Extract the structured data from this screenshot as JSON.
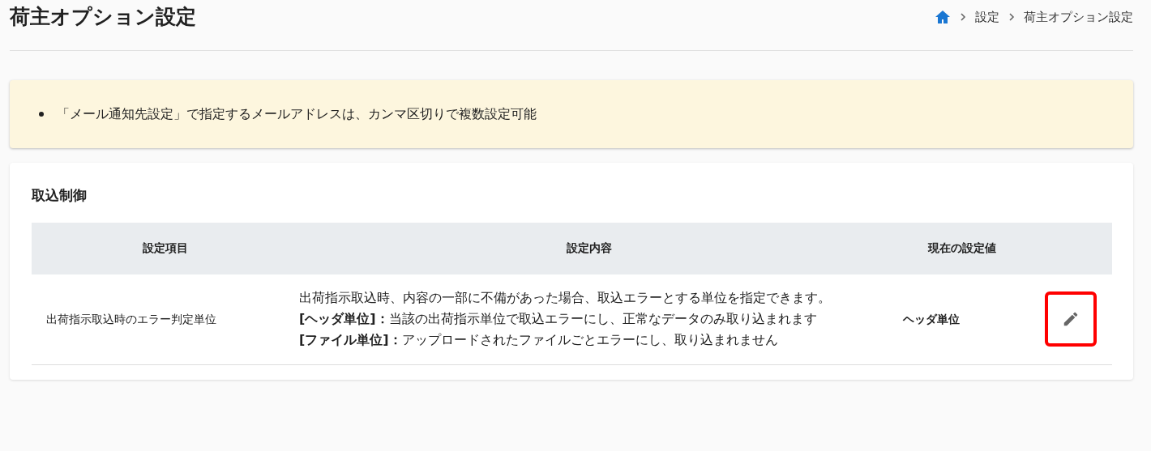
{
  "page_title": "荷主オプション設定",
  "breadcrumb": [
    {
      "kind": "home"
    },
    {
      "kind": "text",
      "label": "設定"
    },
    {
      "kind": "text",
      "label": "荷主オプション設定"
    }
  ],
  "notice": {
    "items": [
      "「メール通知先設定」で指定するメールアドレスは、カンマ区切りで複数設定可能"
    ]
  },
  "section": {
    "title": "取込制御",
    "table": {
      "columns": [
        "設定項目",
        "設定内容",
        "現在の設定値"
      ],
      "rows": [
        {
          "item": "出荷指示取込時のエラー判定単位",
          "description": [
            "出荷指示取込時、内容の一部に不備があった場合、取込エラーとする単位を指定できます。",
            "**[ヘッダ単位]：**当該の出荷指示単位で取込エラーにし、正常なデータのみ取り込まれます",
            "**[ファイル単位]：**アップロードされたファイルごとエラーにし、取り込まれません"
          ],
          "value": "ヘッダ単位",
          "edit_highlighted": true
        }
      ]
    }
  }
}
